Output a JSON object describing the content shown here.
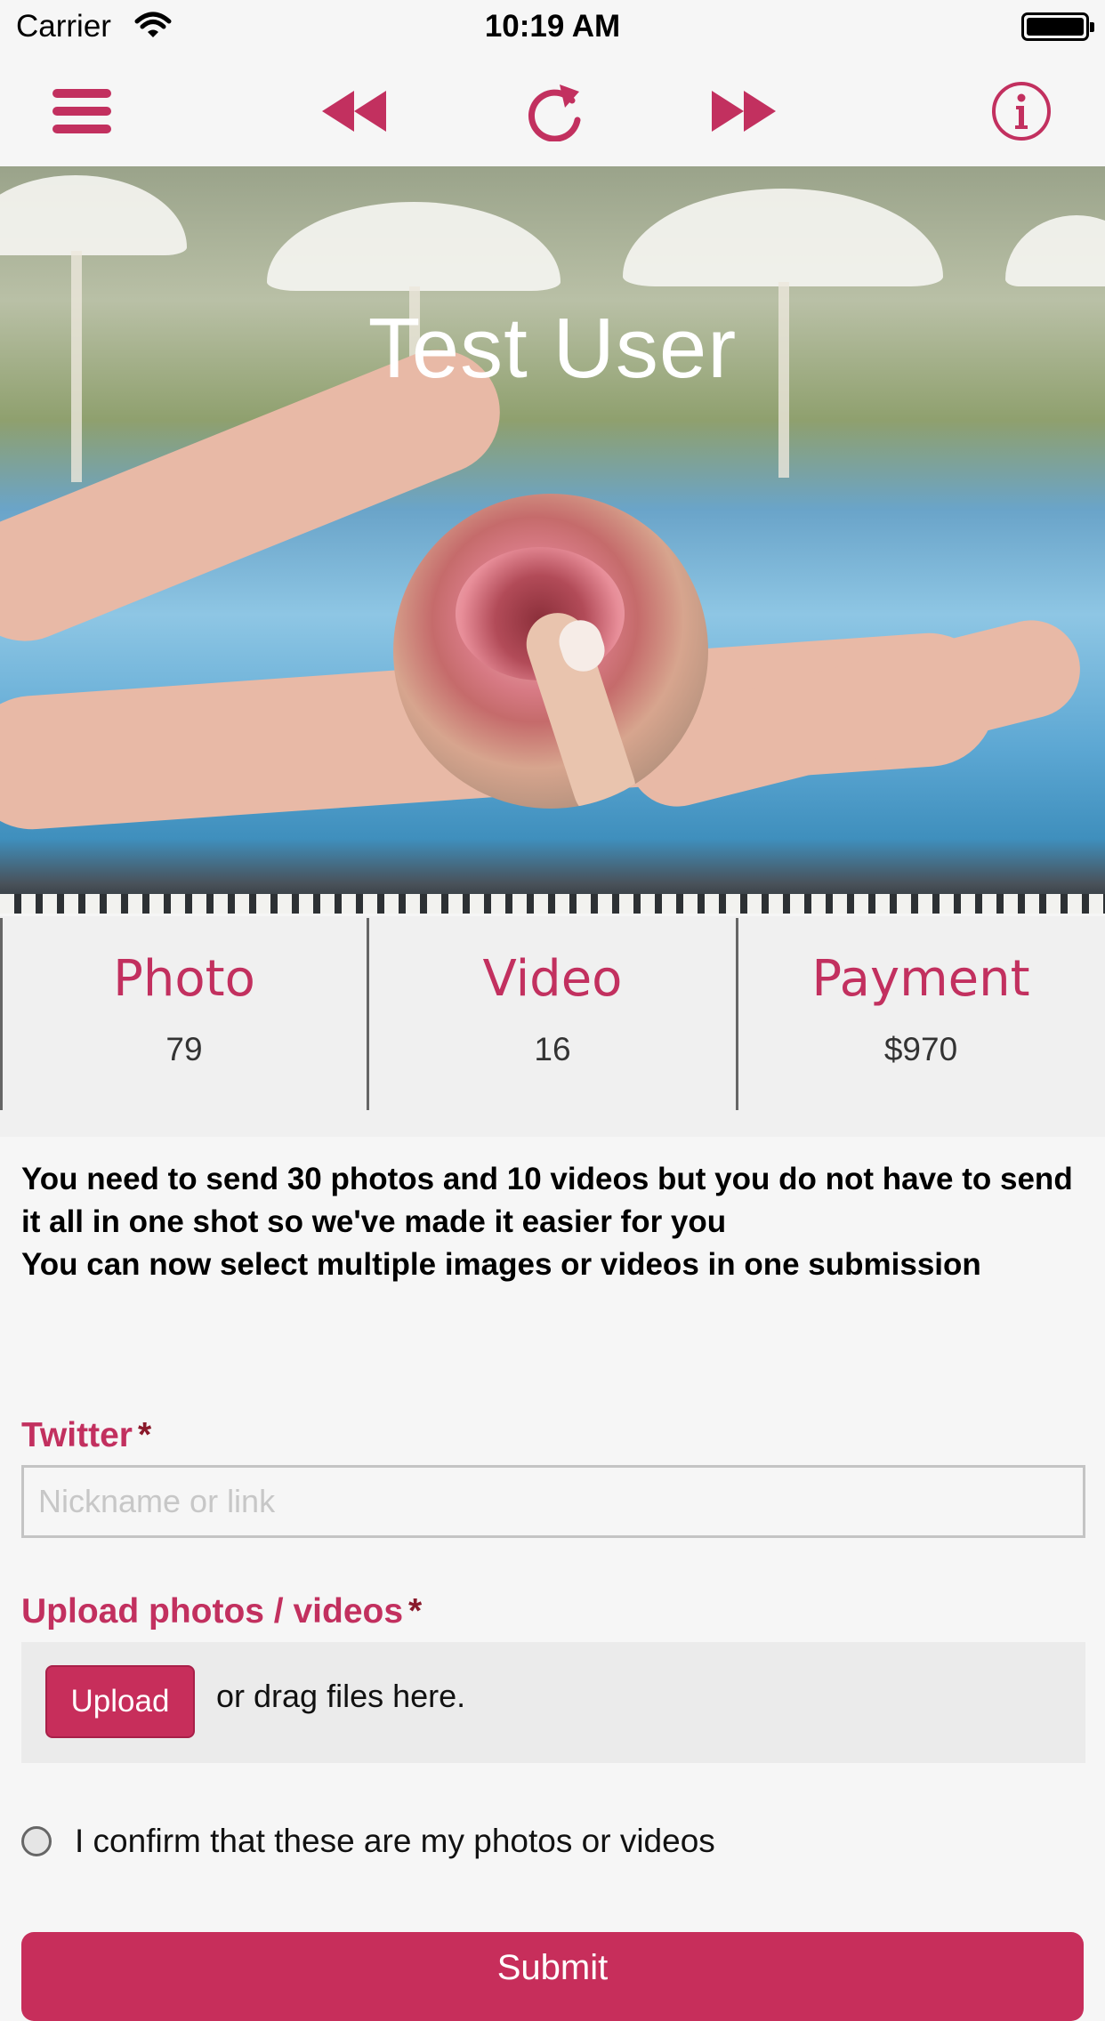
{
  "status_bar": {
    "carrier": "Carrier",
    "time": "10:19 AM"
  },
  "toolbar": {
    "icons": [
      "menu-icon",
      "rewind-icon",
      "refresh-icon",
      "fast-forward-icon",
      "info-icon"
    ],
    "accent_color": "#c2305f"
  },
  "hero": {
    "title": "Test User"
  },
  "stats": [
    {
      "label": "Photo",
      "value": "79"
    },
    {
      "label": "Video",
      "value": "16"
    },
    {
      "label": "Payment",
      "value": "$970"
    }
  ],
  "notice": {
    "line1": "You need to send 30 photos and 10 videos but you do not have to send it all in one shot so we've made it easier for you",
    "line2": "You can now select multiple images or videos in one submission"
  },
  "form": {
    "twitter_label": "Twitter",
    "required_mark": "*",
    "twitter_placeholder": "Nickname or link",
    "upload_label": "Upload photos / videos",
    "upload_button": "Upload",
    "drag_text": "or drag files here.",
    "confirm_text": "I confirm that these are my photos or videos",
    "submit_label": "Submit"
  },
  "colors": {
    "brand": "#c72e5b",
    "background": "#f6f6f6"
  }
}
